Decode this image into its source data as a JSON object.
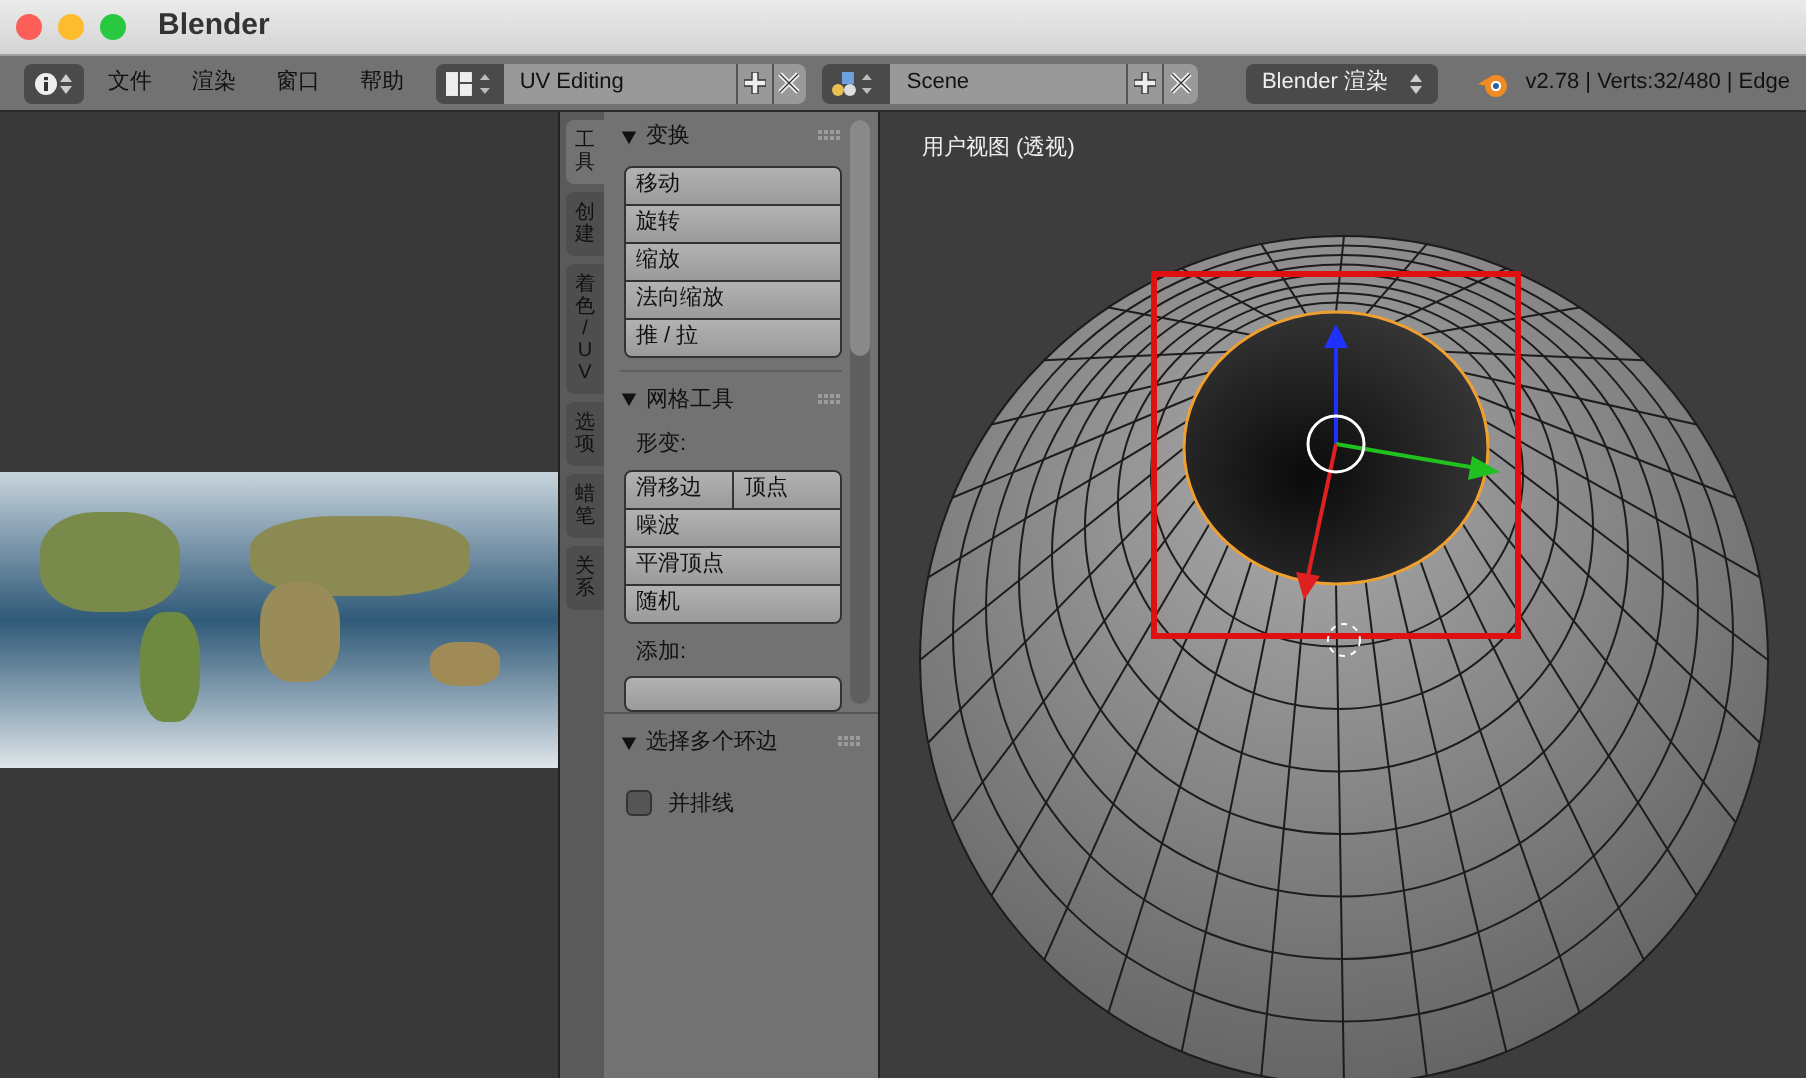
{
  "window": {
    "title": "Blender"
  },
  "header": {
    "menus": [
      "文件",
      "渲染",
      "窗口",
      "帮助"
    ],
    "layout": "UV Editing",
    "scene": "Scene",
    "engine": "Blender 渲染",
    "stats": "v2.78 | Verts:32/480 | Edge"
  },
  "tool_tabs": [
    {
      "label": "工具",
      "selected": true
    },
    {
      "label": "创建",
      "selected": false
    },
    {
      "label": "着色 / UV",
      "selected": false
    },
    {
      "label": "选项",
      "selected": false
    },
    {
      "label": "蜡笔",
      "selected": false
    },
    {
      "label": "关系",
      "selected": false
    }
  ],
  "panels": [
    {
      "title": "变换",
      "expanded": true,
      "groups": [
        {
          "buttons": [
            [
              "移动"
            ],
            [
              "旋转"
            ],
            [
              "缩放"
            ],
            [
              "法向缩放"
            ],
            [
              "推 / 拉"
            ]
          ]
        }
      ]
    },
    {
      "title": "网格工具",
      "expanded": true,
      "groups": [
        {
          "label": "形变:",
          "buttons": [
            [
              "滑移边",
              "顶点"
            ],
            [
              "噪波"
            ],
            [
              "平滑顶点"
            ],
            [
              "随机"
            ]
          ]
        },
        {
          "label": "添加:"
        }
      ]
    }
  ],
  "operator_panel": {
    "title": "选择多个环边",
    "expanded": true,
    "options": [
      {
        "label": "并排线",
        "checked": false
      }
    ]
  },
  "viewport": {
    "label": "用户视图 (透视)"
  }
}
